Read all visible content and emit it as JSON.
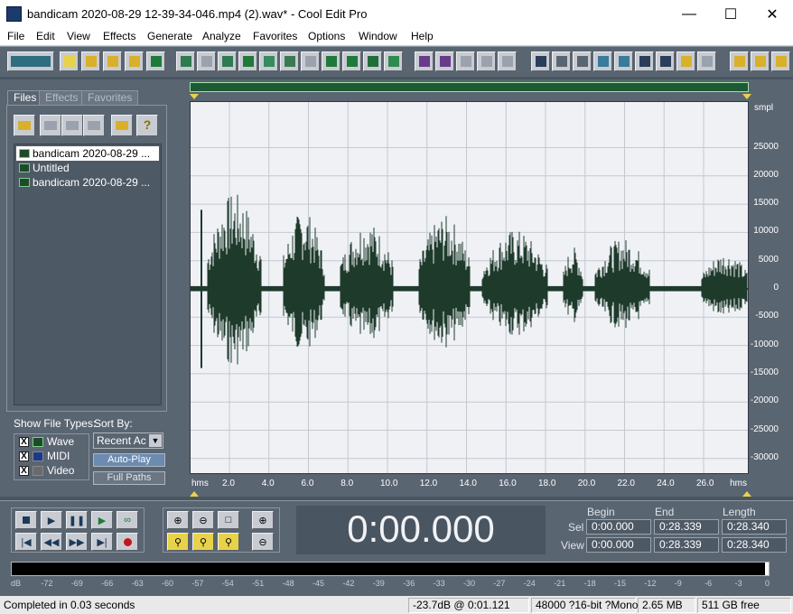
{
  "window": {
    "title": "bandicam 2020-08-29 12-39-34-046.mp4 (2).wav* - Cool Edit Pro"
  },
  "menu": [
    "File",
    "Edit",
    "View",
    "Effects",
    "Generate",
    "Analyze",
    "Favorites",
    "Options",
    "Window",
    "Help"
  ],
  "panel": {
    "tabs": [
      "Files",
      "Effects",
      "Favorites"
    ],
    "files": [
      "bandicam 2020-08-29 ...",
      "Untitled",
      "bandicam 2020-08-29 ..."
    ],
    "show_types_label": "Show File Types:",
    "types": [
      "Wave",
      "MIDI",
      "Video"
    ],
    "sort_label": "Sort By:",
    "sort_value": "Recent Ac",
    "autoplay_label": "Auto-Play",
    "fullpaths_label": "Full Paths"
  },
  "waveform": {
    "y_unit": "smpl",
    "y_ticks": [
      "25000",
      "20000",
      "15000",
      "10000",
      "5000",
      "0",
      "-5000",
      "-10000",
      "-15000",
      "-20000",
      "-25000",
      "-30000"
    ],
    "x_unit": "hms",
    "x_ticks": [
      "2.0",
      "4.0",
      "6.0",
      "8.0",
      "10.0",
      "12.0",
      "14.0",
      "16.0",
      "18.0",
      "20.0",
      "22.0",
      "24.0",
      "26.0"
    ],
    "color": "#1e3a2b",
    "background": "#eff1f5"
  },
  "time_display": "0:00.000",
  "selection": {
    "headers": [
      "Begin",
      "End",
      "Length"
    ],
    "sel_label": "Sel",
    "view_label": "View",
    "sel": [
      "0:00.000",
      "0:28.339",
      "0:28.340"
    ],
    "view": [
      "0:00.000",
      "0:28.339",
      "0:28.340"
    ]
  },
  "meter": {
    "scale": [
      "dB",
      "-72",
      "-69",
      "-66",
      "-63",
      "-60",
      "-57",
      "-54",
      "-51",
      "-48",
      "-45",
      "-42",
      "-39",
      "-36",
      "-33",
      "-30",
      "-27",
      "-24",
      "-21",
      "-18",
      "-15",
      "-12",
      "-9",
      "-6",
      "-3",
      "0"
    ]
  },
  "status": {
    "message": "Completed in 0.03 seconds",
    "level": "-23.7dB @  0:01.121",
    "format": "48000 ?16-bit ?Mono",
    "size": "2.65 MB",
    "free": "511 GB free"
  }
}
